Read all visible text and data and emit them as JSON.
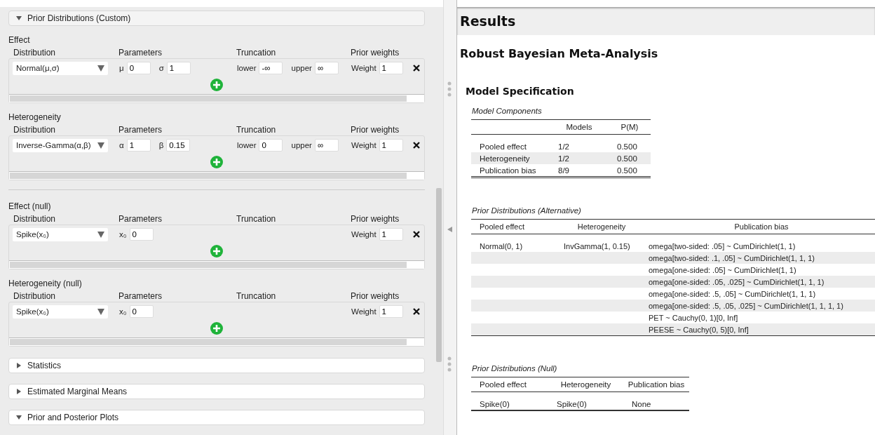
{
  "options_panel": {
    "header": {
      "label": "Prior Distributions (Custom)",
      "expanded": true
    },
    "sections": [
      {
        "title": "Effect",
        "columns": [
          "Distribution",
          "Parameters",
          "Truncation",
          "Prior weights"
        ],
        "distribution": "Normal(μ,σ)",
        "parameters": [
          {
            "symbol": "μ",
            "value": "0"
          },
          {
            "symbol": "σ",
            "value": "1"
          }
        ],
        "truncation": [
          {
            "label": "lower",
            "value": "-∞"
          },
          {
            "label": "upper",
            "value": "∞"
          }
        ],
        "weight_label": "Weight",
        "weight": "1"
      },
      {
        "title": "Heterogeneity",
        "columns": [
          "Distribution",
          "Parameters",
          "Truncation",
          "Prior weights"
        ],
        "distribution": "Inverse-Gamma(α,β)",
        "parameters": [
          {
            "symbol": "α",
            "value": "1"
          },
          {
            "symbol": "β",
            "value": "0.15"
          }
        ],
        "truncation": [
          {
            "label": "lower",
            "value": "0"
          },
          {
            "label": "upper",
            "value": "∞"
          }
        ],
        "weight_label": "Weight",
        "weight": "1"
      },
      {
        "title": "Effect (null)",
        "columns": [
          "Distribution",
          "Parameters",
          "Truncation",
          "Prior weights"
        ],
        "distribution": "Spike(x₀)",
        "parameters": [
          {
            "symbol": "x₀",
            "value": "0"
          }
        ],
        "weight_label": "Weight",
        "weight": "1"
      },
      {
        "title": "Heterogeneity (null)",
        "columns": [
          "Distribution",
          "Parameters",
          "Truncation",
          "Prior weights"
        ],
        "distribution": "Spike(x₀)",
        "parameters": [
          {
            "symbol": "x₀",
            "value": "0"
          }
        ],
        "weight_label": "Weight",
        "weight": "1"
      }
    ],
    "collapsibles": [
      {
        "label": "Statistics",
        "expanded": false
      },
      {
        "label": "Estimated Marginal Means",
        "expanded": false
      },
      {
        "label": "Prior and Posterior Plots",
        "expanded": true
      }
    ]
  },
  "results": {
    "title": "Results",
    "analysis_title": "Robust Bayesian Meta-Analysis",
    "subtitle": "Model Specification",
    "model_components": {
      "caption": "Model Components",
      "columns": [
        "",
        "Models",
        "P(M)"
      ],
      "rows": [
        [
          "Pooled effect",
          "1/2",
          "0.500"
        ],
        [
          "Heterogeneity",
          "1/2",
          "0.500"
        ],
        [
          "Publication bias",
          "8/9",
          "0.500"
        ]
      ]
    },
    "prior_alternative": {
      "caption": "Prior Distributions (Alternative)",
      "columns": [
        "Pooled effect",
        "Heterogeneity",
        "Publication bias"
      ],
      "pooled_effect": "Normal(0, 1)",
      "heterogeneity": "InvGamma(1, 0.15)",
      "publication_bias": [
        "omega[two-sided: .05] ~ CumDirichlet(1, 1)",
        "omega[two-sided: .1, .05] ~ CumDirichlet(1, 1, 1)",
        "omega[one-sided: .05] ~ CumDirichlet(1, 1)",
        "omega[one-sided: .05, .025] ~ CumDirichlet(1, 1, 1)",
        "omega[one-sided: .5, .05] ~ CumDirichlet(1, 1, 1)",
        "omega[one-sided: .5, .05, .025] ~ CumDirichlet(1, 1, 1, 1)",
        "PET ~ Cauchy(0, 1)[0, Inf]",
        "PEESE ~ Cauchy(0, 5)[0, Inf]"
      ]
    },
    "prior_null": {
      "caption": "Prior Distributions (Null)",
      "columns": [
        "Pooled effect",
        "Heterogeneity",
        "Publication bias"
      ],
      "rows": [
        [
          "Spike(0)",
          "Spike(0)",
          "None"
        ]
      ]
    }
  }
}
